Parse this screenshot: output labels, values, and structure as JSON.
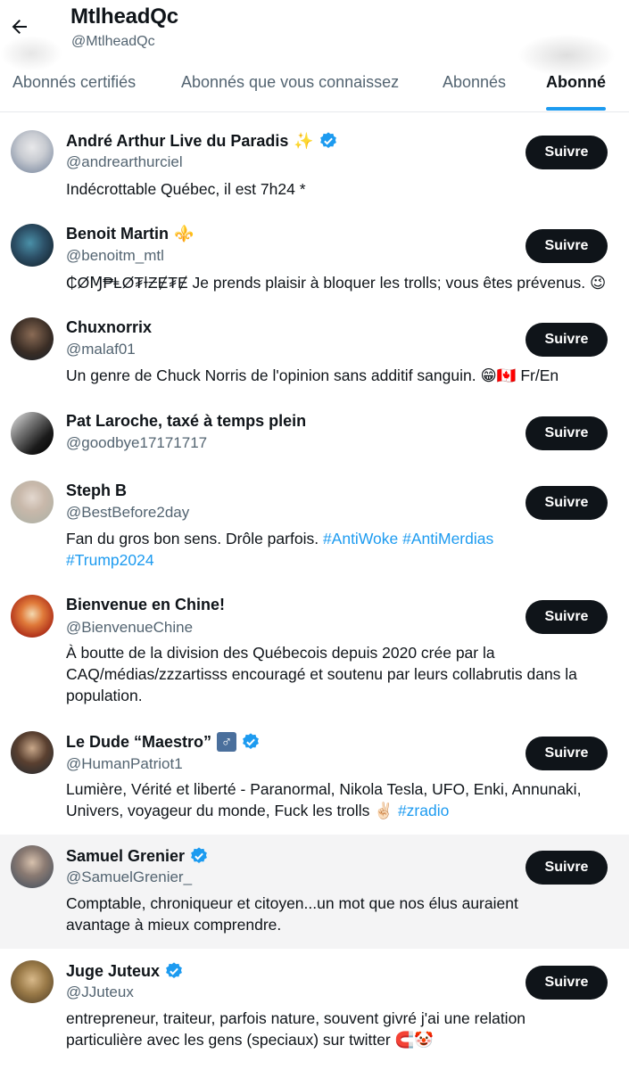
{
  "header": {
    "name": "MtlheadQc",
    "handle": "@MtlheadQc"
  },
  "tabs": [
    {
      "label": "Abonnés certifiés",
      "active": false
    },
    {
      "label": "Abonnés que vous connaissez",
      "active": false
    },
    {
      "label": "Abonnés",
      "active": false
    },
    {
      "label": "Abonné",
      "active": true
    }
  ],
  "colors": {
    "accent": "#1d9bf0",
    "button": "#0f1419",
    "secondary_text": "#536471"
  },
  "users": [
    {
      "name": "André Arthur Live du Paradis",
      "emoji": "✨",
      "verified": true,
      "handle": "@andrearthurciel",
      "bio": [
        "Indécrottable Québec, il est 7h24 *"
      ],
      "button": "Suivre"
    },
    {
      "name": "Benoit Martin",
      "emoji": "⚜️",
      "verified": false,
      "handle": "@benoitm_mtl",
      "bio": [
        "₵ØⱮ₱ⱠØ₮ƗƵɆ₮Ɇ Je prends plaisir à bloquer les trolls; vous êtes prévenus. 😉"
      ],
      "button": "Suivre"
    },
    {
      "name": "Chuxnorrix",
      "emoji": "",
      "verified": false,
      "handle": "@malaf01",
      "bio": [
        "Un genre de Chuck Norris de l'opinion sans additif sanguin. 😁🇨🇦 Fr/En"
      ],
      "button": "Suivre"
    },
    {
      "name": "Pat Laroche, taxé à temps plein",
      "emoji": "",
      "verified": false,
      "handle": "@goodbye17171717",
      "bio": [],
      "button": "Suivre"
    },
    {
      "name": "Steph B",
      "emoji": "",
      "verified": false,
      "handle": "@BestBefore2day",
      "bio": [
        "Fan du gros bon sens. Drôle parfois. ",
        "#AntiWoke #AntiMerdias",
        "#Trump2024"
      ],
      "button": "Suivre"
    },
    {
      "name": "Bienvenue en Chine!",
      "emoji": "",
      "verified": false,
      "handle": "@BienvenueChine",
      "bio": [
        "À boutte de la division des Québecois depuis 2020 crée par la",
        "CAQ/médias/zzzartisss encouragé et soutenu par leurs collabrutis dans la",
        "population."
      ],
      "button": "Suivre"
    },
    {
      "name": "Le Dude “Maestro”",
      "emoji": "♂",
      "verified": true,
      "handle": "@HumanPatriot1",
      "bio": [
        "Lumière, Vérité et liberté - Paranormal, Nikola Tesla, UFO, Enki, Annunaki,",
        "Univers, voyageur du monde, Fuck les trolls ✌🏻 ",
        "#zradio"
      ],
      "button": "Suivre"
    },
    {
      "name": "Samuel Grenier",
      "emoji": "",
      "verified": true,
      "handle": "@SamuelGrenier_",
      "bio": [
        "Comptable, chroniqueur et citoyen...un mot que nos élus auraient",
        "avantage à mieux comprendre."
      ],
      "button": "Suivre"
    },
    {
      "name": "Juge Juteux",
      "emoji": "",
      "verified": true,
      "handle": "@JJuteux",
      "bio": [
        "entrepreneur, traiteur, parfois nature, souvent givré j'ai une relation",
        "particulière avec les gens (speciaux) sur twitter 🧲🤡"
      ],
      "button": "Suivre"
    }
  ]
}
